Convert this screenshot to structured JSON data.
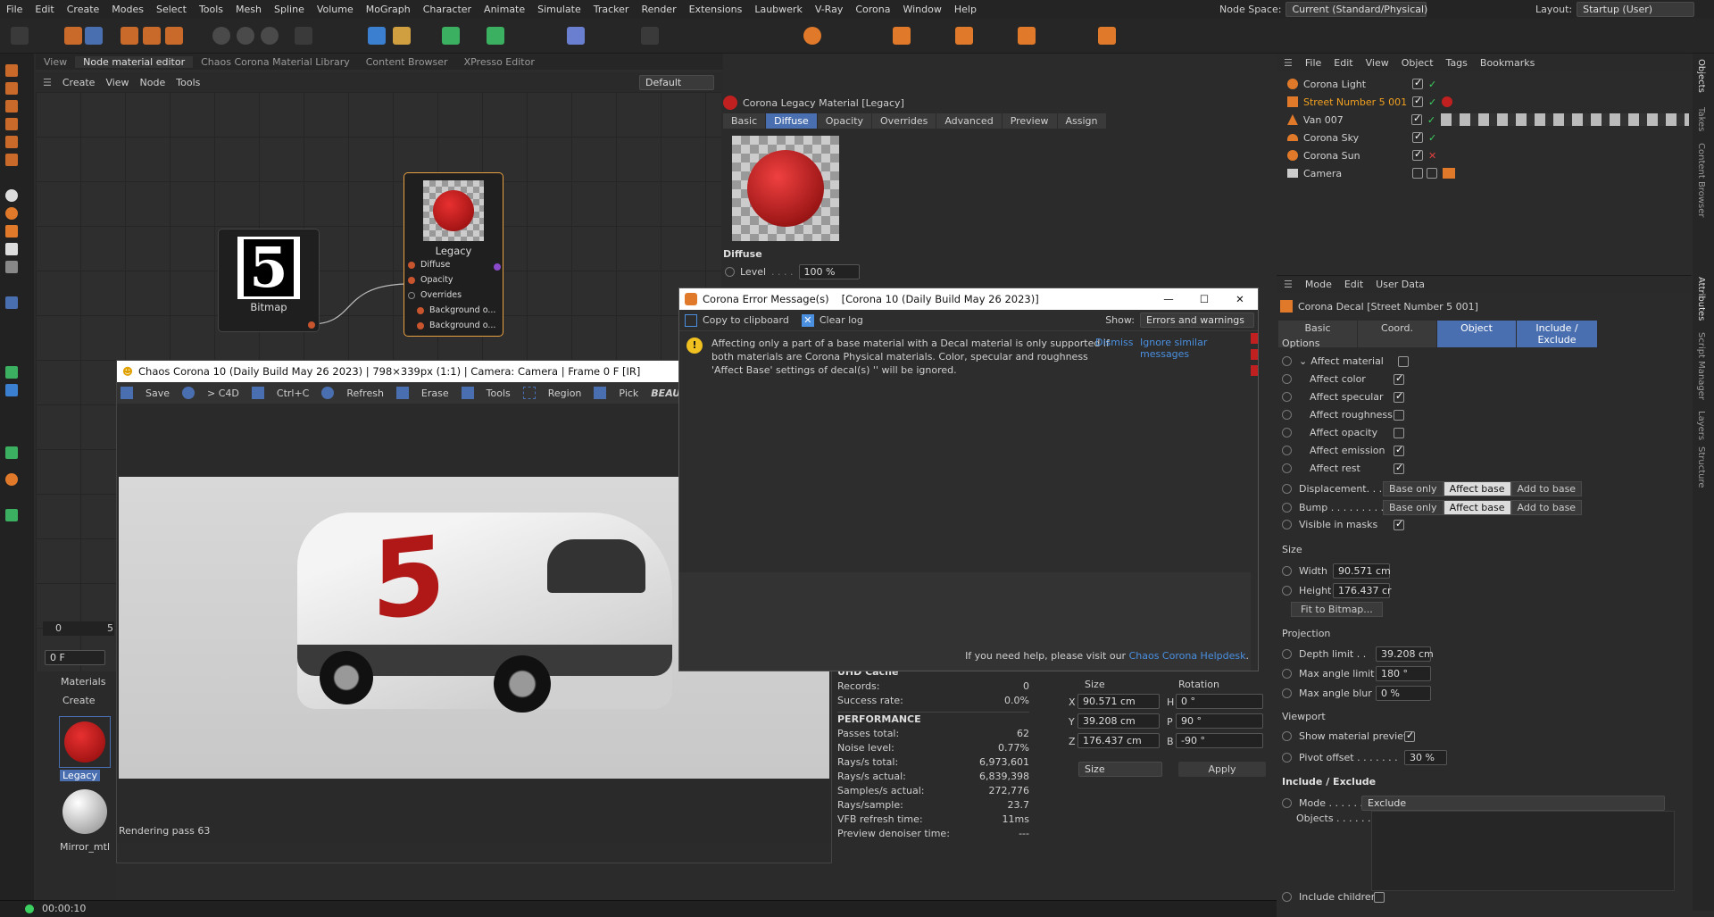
{
  "menubar": {
    "items": [
      "File",
      "Edit",
      "Create",
      "Modes",
      "Select",
      "Tools",
      "Mesh",
      "Spline",
      "Volume",
      "MoGraph",
      "Character",
      "Animate",
      "Simulate",
      "Tracker",
      "Render",
      "Extensions",
      "Laubwerk",
      "V-Ray",
      "Corona",
      "Window",
      "Help"
    ],
    "node_space_label": "Node Space:",
    "node_space_value": "Current (Standard/Physical)",
    "layout_label": "Layout:",
    "layout_value": "Startup (User)"
  },
  "node_editor": {
    "tabs": [
      "View",
      "Node material editor",
      "Chaos Corona Material Library",
      "Content Browser",
      "XPresso Editor"
    ],
    "menu": [
      "Create",
      "View",
      "Node",
      "Tools"
    ],
    "dropdown": "Default",
    "bitmap_label": "Bitmap",
    "bitmap_digit": "5",
    "legacy_label": "Legacy",
    "ports": [
      "Diffuse",
      "Opacity",
      "Overrides",
      "Background o...",
      "Background o..."
    ]
  },
  "material_panel": {
    "title": "Corona Legacy Material [Legacy]",
    "tabs": [
      "Basic",
      "Diffuse",
      "Opacity",
      "Overrides",
      "Advanced",
      "Preview",
      "Assign"
    ],
    "section": "Diffuse",
    "level_label": "Level",
    "level_value": "100 %"
  },
  "error_dialog": {
    "title": "Corona Error Message(s)",
    "build": "[Corona 10 (Daily Build May 26 2023)]",
    "copy_label": "Copy to clipboard",
    "clear_label": "Clear log",
    "show_label": "Show:",
    "show_value": "Errors and warnings",
    "message_1": "Affecting only a part of a base material with a Decal material is only supported if",
    "message_2": "both materials are Corona Physical materials. Color, specular and roughness",
    "message_3": "'Affect Base' settings of decal(s) '' will be ignored.",
    "dismiss": "Dismiss",
    "ignore": "Ignore similar messages",
    "help_text": "If you need help, please visit our",
    "help_link": "Chaos Corona Helpdesk",
    "help_end": "."
  },
  "vfb": {
    "title": "Chaos Corona 10 (Daily Build May 26 2023) | 798×339px (1:1) | Camera: Camera | Frame 0 F [IR]",
    "toolbar": [
      "Save",
      "> C4D",
      "Ctrl+C",
      "Refresh",
      "Erase",
      "Tools",
      "Region",
      "Pick"
    ],
    "beauty": "BEAU",
    "status": "Rendering pass 63",
    "van_number": "5",
    "stats_cache_header": "UHD Cache",
    "stats_perf_header": "PERFORMANCE",
    "cache": [
      {
        "k": "Records:",
        "v": "0"
      },
      {
        "k": "Success rate:",
        "v": "0.0%"
      }
    ],
    "perf": [
      {
        "k": "Passes total:",
        "v": "62"
      },
      {
        "k": "Noise level:",
        "v": "0.77%"
      },
      {
        "k": "Rays/s total:",
        "v": "6,973,601"
      },
      {
        "k": "Rays/s actual:",
        "v": "6,839,398"
      },
      {
        "k": "Samples/s actual:",
        "v": "272,776"
      },
      {
        "k": "Rays/sample:",
        "v": "23.7"
      },
      {
        "k": "VFB refresh time:",
        "v": "11ms"
      },
      {
        "k": "Preview denoiser time:",
        "v": "---"
      }
    ]
  },
  "timeline": {
    "frame": "0 F",
    "start": "0",
    "mark": "5"
  },
  "materials": {
    "tab": "Materials",
    "create": "Create",
    "items": [
      "Legacy",
      "Mirror_mtl"
    ]
  },
  "coords": {
    "size_header": "Size",
    "rotation_header": "Rotation",
    "x": "90.571 cm",
    "y": "39.208 cm",
    "z": "176.437 cm",
    "h": "0 °",
    "p": "90 °",
    "b": "-90 °",
    "size_mode": "Size",
    "apply": "Apply",
    "lx": "X",
    "ly": "Y",
    "lz": "Z",
    "lh": "H",
    "lp": "P",
    "lb": "B"
  },
  "object_manager": {
    "menu": [
      "File",
      "Edit",
      "View",
      "Object",
      "Tags",
      "Bookmarks"
    ],
    "objects": [
      {
        "name": "Corona Light",
        "color": "#d0d0d0"
      },
      {
        "name": "Street Number 5 001",
        "color": "#f0a020"
      },
      {
        "name": "Van 007",
        "color": "#d0d0d0"
      },
      {
        "name": "Corona Sky",
        "color": "#d0d0d0"
      },
      {
        "name": "Corona Sun",
        "color": "#d0d0d0"
      },
      {
        "name": "Camera",
        "color": "#d0d0d0"
      }
    ]
  },
  "attributes": {
    "menu": [
      "Mode",
      "Edit",
      "User Data"
    ],
    "object_title": "Corona Decal [Street Number 5 001]",
    "tabs": [
      "Basic",
      "Coord.",
      "Object",
      "Include / Exclude"
    ],
    "options_header": "Options",
    "affect_material": "Affect material",
    "affects": [
      {
        "label": "Affect color",
        "on": true
      },
      {
        "label": "Affect specular",
        "on": true
      },
      {
        "label": "Affect roughness",
        "on": false
      },
      {
        "label": "Affect opacity",
        "on": false
      },
      {
        "label": "Affect emission",
        "on": true
      },
      {
        "label": "Affect rest",
        "on": true
      }
    ],
    "displacement": "Displacement. . . .",
    "bump": "Bump . . . . . . . . .",
    "modes": [
      "Base only",
      "Affect base",
      "Add to base"
    ],
    "visible_masks": "Visible in masks",
    "size_header": "Size",
    "width_label": "Width",
    "width_value": "90.571 cm",
    "height_label": "Height",
    "height_value": "176.437 cr",
    "fit_bitmap": "Fit to Bitmap...",
    "projection_header": "Projection",
    "depth_label": "Depth limit . .",
    "depth_value": "39.208 cm",
    "max_angle_label": "Max angle limit",
    "max_angle_value": "180 °",
    "max_blur_label": "Max angle blur",
    "max_blur_value": "0 %",
    "viewport_header": "Viewport",
    "show_preview": "Show material preview",
    "pivot_label": "Pivot offset . . . . . . .",
    "pivot_value": "30 %",
    "include_header": "Include / Exclude",
    "mode_label": "Mode . . . . . . .",
    "mode_value": "Exclude",
    "objects_label": "Objects . . . . . .",
    "include_children": "Include children"
  },
  "side_tabs": [
    "Objects",
    "Takes",
    "Content Browser",
    "Attributes",
    "Script Manager",
    "Layers",
    "Structure"
  ],
  "status": {
    "time": "00:00:10"
  },
  "colors": {
    "accent": "#4a6fb0",
    "orange": "#e07a2a",
    "legacy_border": "#e8a040"
  }
}
